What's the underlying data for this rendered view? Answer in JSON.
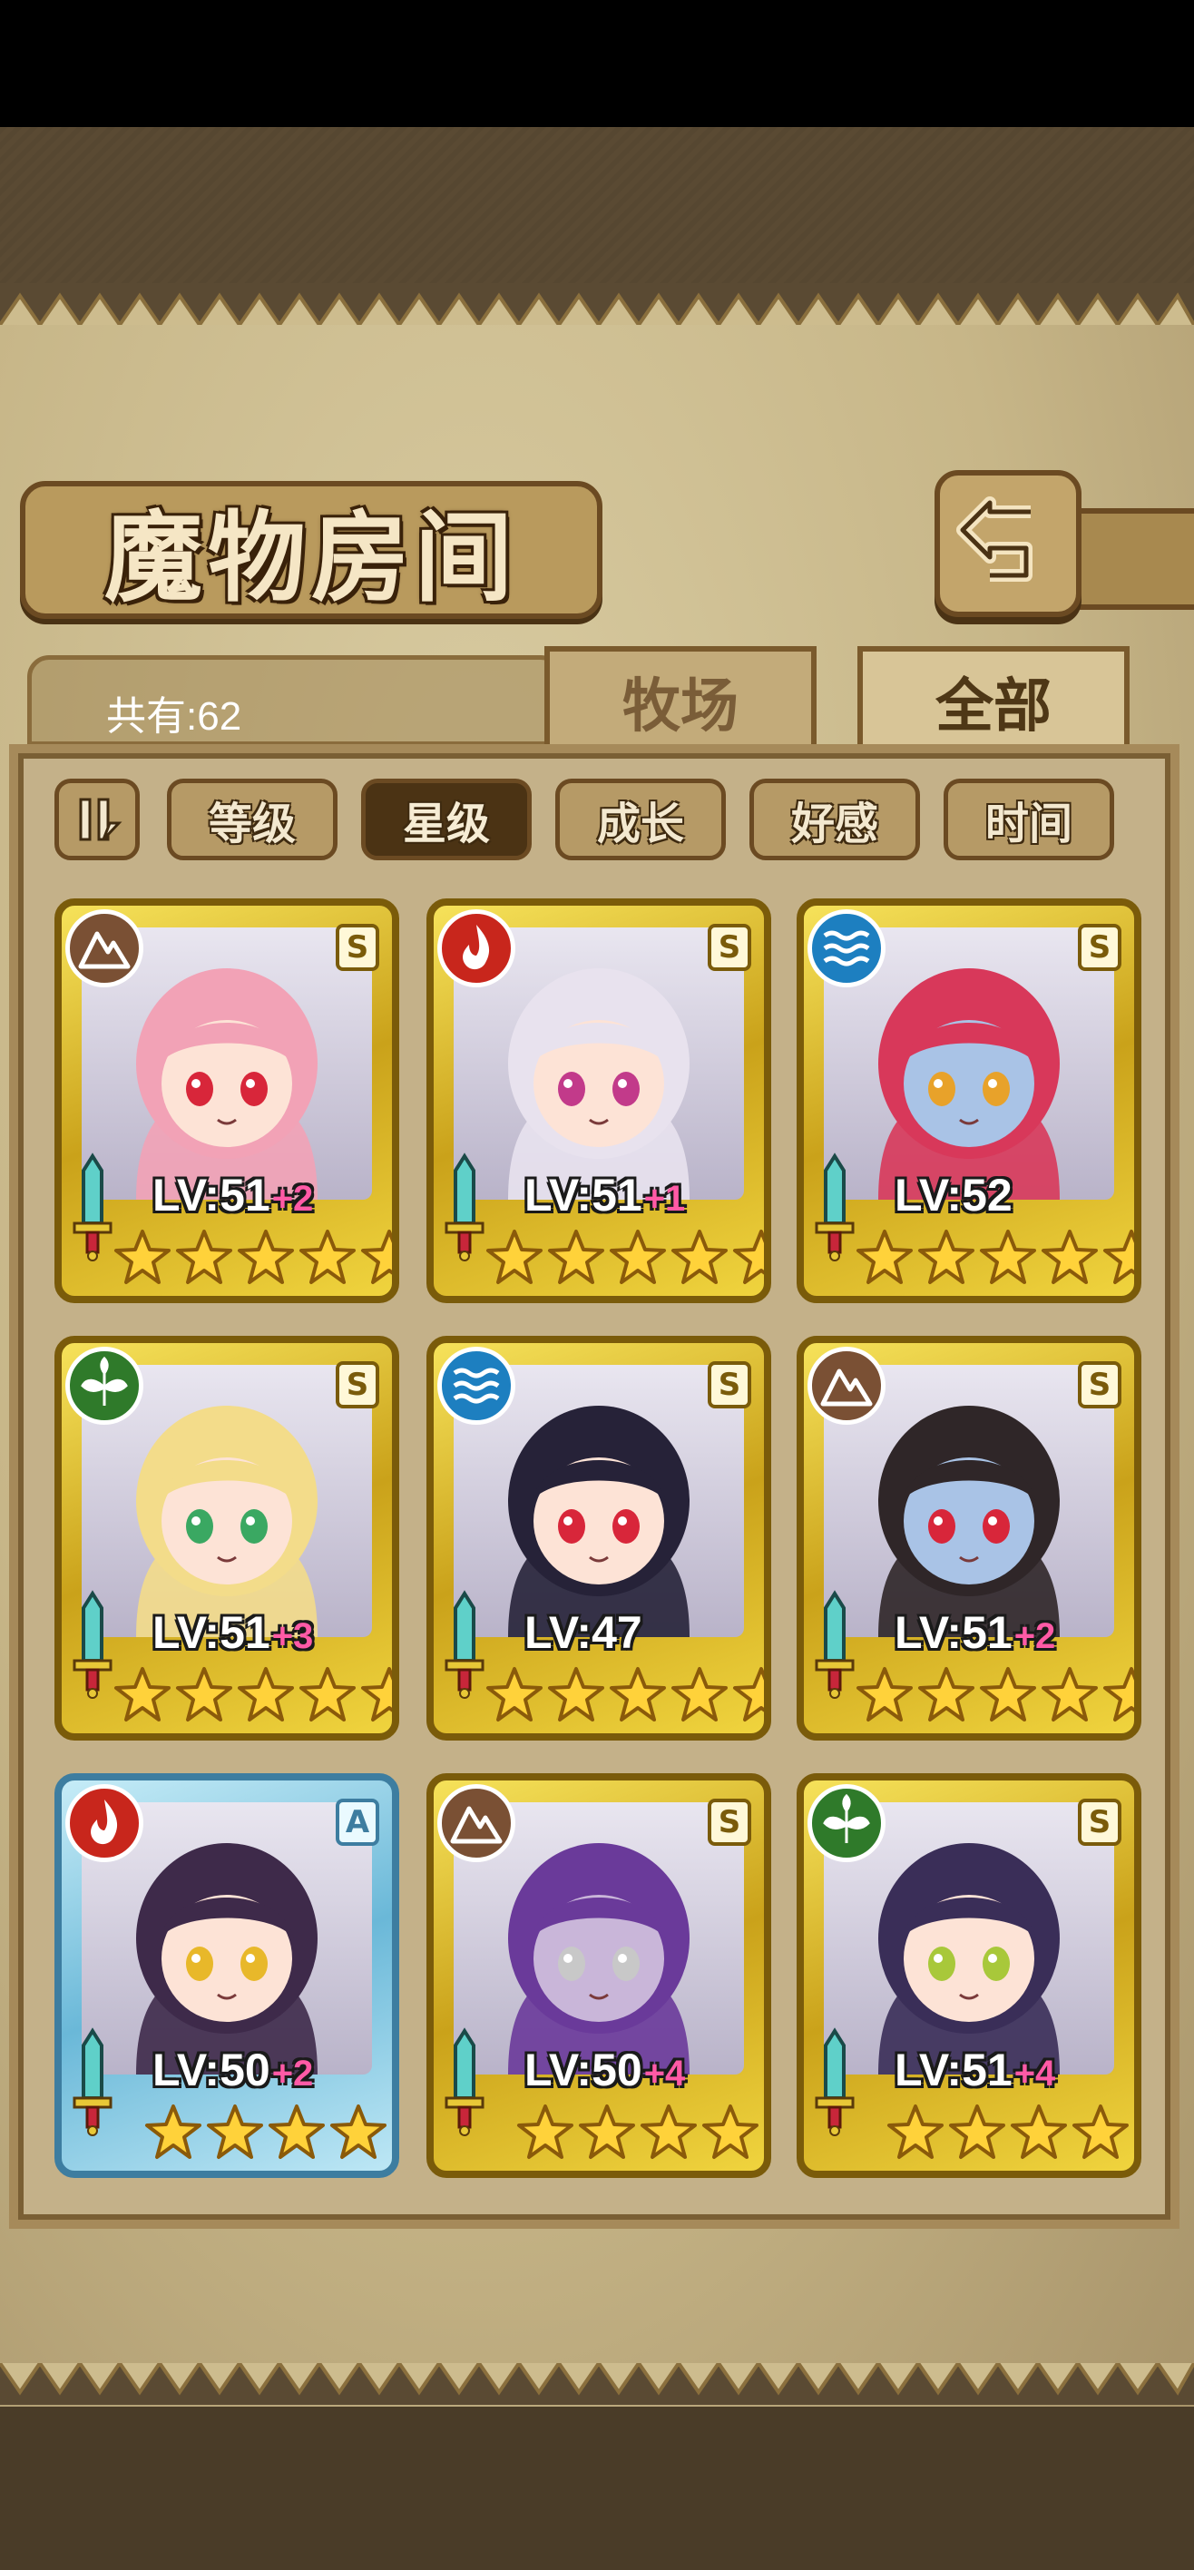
{
  "title": "魔物房间",
  "count_label": "共有:62",
  "tabs": [
    {
      "label": "牧场",
      "active": false
    },
    {
      "label": "全部",
      "active": true
    }
  ],
  "sort": {
    "toggle_icon": "pause-sort-toggle-icon",
    "buttons": [
      {
        "label": "等级",
        "active": false
      },
      {
        "label": "星级",
        "active": true
      },
      {
        "label": "成长",
        "active": false
      },
      {
        "label": "好感",
        "active": false
      },
      {
        "label": "时间",
        "active": false
      }
    ]
  },
  "colors": {
    "fire": "#c8261c",
    "water": "#1d7fc0",
    "earth": "#7a5034",
    "wood": "#2f7a2a",
    "gold_frame": "#e8c837",
    "blue_frame": "#8fd1e8",
    "bonus": "#ff5aa6"
  },
  "monsters": [
    {
      "element": "earth",
      "rank": "S",
      "level": "LV:51",
      "bonus": "+2",
      "stars": 5,
      "frame": "gold"
    },
    {
      "element": "fire",
      "rank": "S",
      "level": "LV:51",
      "bonus": "+1",
      "stars": 5,
      "frame": "gold"
    },
    {
      "element": "water",
      "rank": "S",
      "level": "LV:52",
      "bonus": "",
      "stars": 5,
      "frame": "gold"
    },
    {
      "element": "wood",
      "rank": "S",
      "level": "LV:51",
      "bonus": "+3",
      "stars": 5,
      "frame": "gold"
    },
    {
      "element": "water",
      "rank": "S",
      "level": "LV:47",
      "bonus": "",
      "stars": 5,
      "frame": "gold"
    },
    {
      "element": "earth",
      "rank": "S",
      "level": "LV:51",
      "bonus": "+2",
      "stars": 5,
      "frame": "gold"
    },
    {
      "element": "fire",
      "rank": "A",
      "level": "LV:50",
      "bonus": "+2",
      "stars": 4,
      "frame": "blue"
    },
    {
      "element": "earth",
      "rank": "S",
      "level": "LV:50",
      "bonus": "+4",
      "stars": 4,
      "frame": "gold"
    },
    {
      "element": "wood",
      "rank": "S",
      "level": "LV:51",
      "bonus": "+4",
      "stars": 4,
      "frame": "gold"
    }
  ]
}
